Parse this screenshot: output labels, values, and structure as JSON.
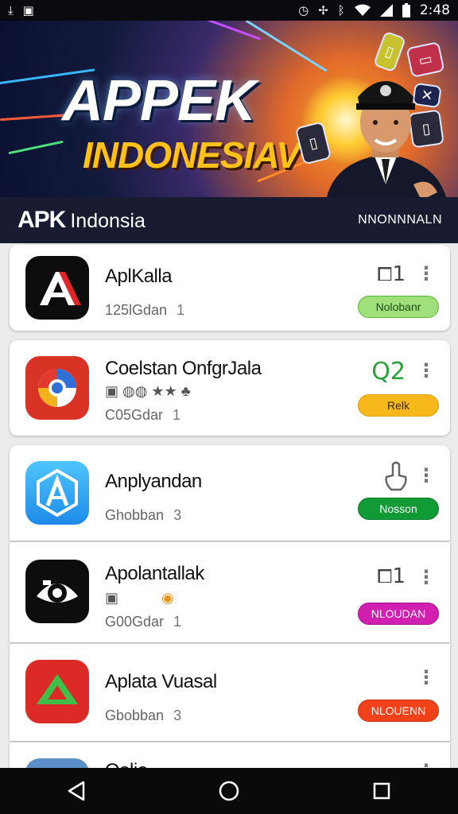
{
  "status_bar": {
    "time": "2:48",
    "left_icons": [
      "download-icon",
      "image-icon"
    ],
    "right_icons": [
      "alarm-icon",
      "signal-alt-icon",
      "bluetooth-icon",
      "wifi-icon",
      "cell-signal-icon",
      "battery-icon"
    ]
  },
  "banner": {
    "title_line1": "APPEK",
    "title_line2": "INDONESIAV"
  },
  "app_bar": {
    "title_bold": "APK",
    "title_rest": "Indonsia",
    "menu_label": "NNONNNALN"
  },
  "apps": [
    {
      "name": "AplKalla",
      "meta": "125lGdan",
      "meta_num": "1",
      "side_stat": "1",
      "side_icon": "copy-icon",
      "button_label": "Nolobanr",
      "button_bg": "#9fe07a",
      "button_fg": "#224d14",
      "button_border": "#5fb33a",
      "icon_bg": "#0d0d0d",
      "icon_name": "red-a-logo-icon"
    },
    {
      "name": "Coelstan OnfgrJala",
      "meta": "C05Gdar",
      "meta_num": "1",
      "side_stat": "Q2",
      "side_stat_color": "#2aa13a",
      "button_label": "Relk",
      "button_bg": "#f7b81c",
      "button_fg": "#3a2800",
      "button_border": "#e0a00c",
      "emblems": "▣ ◍◍ ★★ ♣",
      "icon_bg": "#d93326",
      "icon_name": "circle-logo-icon"
    },
    {
      "name": "Anplyandan",
      "meta": "Ghobban",
      "meta_num": "3",
      "side_icon": "touch-icon",
      "button_label": "Nosson",
      "button_bg": "#129a36",
      "button_fg": "#ffffff",
      "button_border": "#0d7a2a",
      "icon_bg": "#34a6f0",
      "icon_name": "blue-a-logo-icon"
    },
    {
      "name": "Apolantallak",
      "meta": "G00Gdar",
      "meta_num": "1",
      "side_stat": "1",
      "side_icon": "copy-icon",
      "button_label": "NLOUDAN",
      "button_bg": "#d11fb0",
      "button_fg": "#ffffff",
      "button_border": "#a8128c",
      "emblems": "▣ ◉",
      "icon_bg": "#0d0d0d",
      "icon_name": "camera-logo-icon"
    },
    {
      "name": "Aplata Vuasal",
      "meta": "Gbobban",
      "meta_num": "3",
      "button_label": "NLOUENN",
      "button_bg": "#f2421a",
      "button_fg": "#ffffff",
      "button_border": "#c92e0c",
      "icon_bg": "#dc2b26",
      "icon_name": "green-triangle-logo-icon"
    },
    {
      "name": "Oolio",
      "icon_bg": "#5a8fc8",
      "icon_name": "partial-logo-icon"
    }
  ],
  "nav_bar": {
    "icons": [
      "back-icon",
      "home-icon",
      "recents-icon"
    ]
  }
}
